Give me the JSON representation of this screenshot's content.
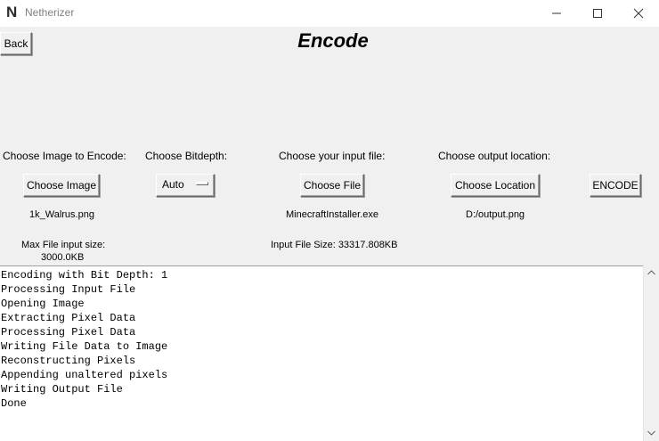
{
  "window": {
    "title": "Netherizer",
    "icon_glyph": "N"
  },
  "header": {
    "back_label": "Back",
    "title": "Encode"
  },
  "image_section": {
    "label": "Choose Image to Encode:",
    "button": "Choose Image",
    "filename": "1k_Walrus.png",
    "max_size_label": "Max File input size:",
    "max_size_value": "3000.0KB"
  },
  "bitdepth_section": {
    "label": "Choose Bitdepth:",
    "selected": "Auto"
  },
  "input_section": {
    "label": "Choose your input file:",
    "button": "Choose File",
    "filename": "MinecraftInstaller.exe",
    "size_text": "Input File Size: 33317.808KB"
  },
  "output_section": {
    "label": "Choose output location:",
    "button": "Choose Location",
    "path": "D:/output.png"
  },
  "encode_button": "ENCODE",
  "log": {
    "lines": [
      "Encoding with Bit Depth: 1",
      "Processing Input File",
      "Opening Image",
      "Extracting Pixel Data",
      "Processing Pixel Data",
      "Writing File Data to Image",
      "Reconstructing Pixels",
      "Appending unaltered pixels",
      "Writing Output File",
      "Done"
    ]
  },
  "icons": {
    "app": "netherizer-logo-icon",
    "minimize": "minimize-icon",
    "maximize": "maximize-icon",
    "close": "close-icon",
    "scroll_up": "chevron-up-icon",
    "scroll_down": "chevron-down-icon"
  }
}
